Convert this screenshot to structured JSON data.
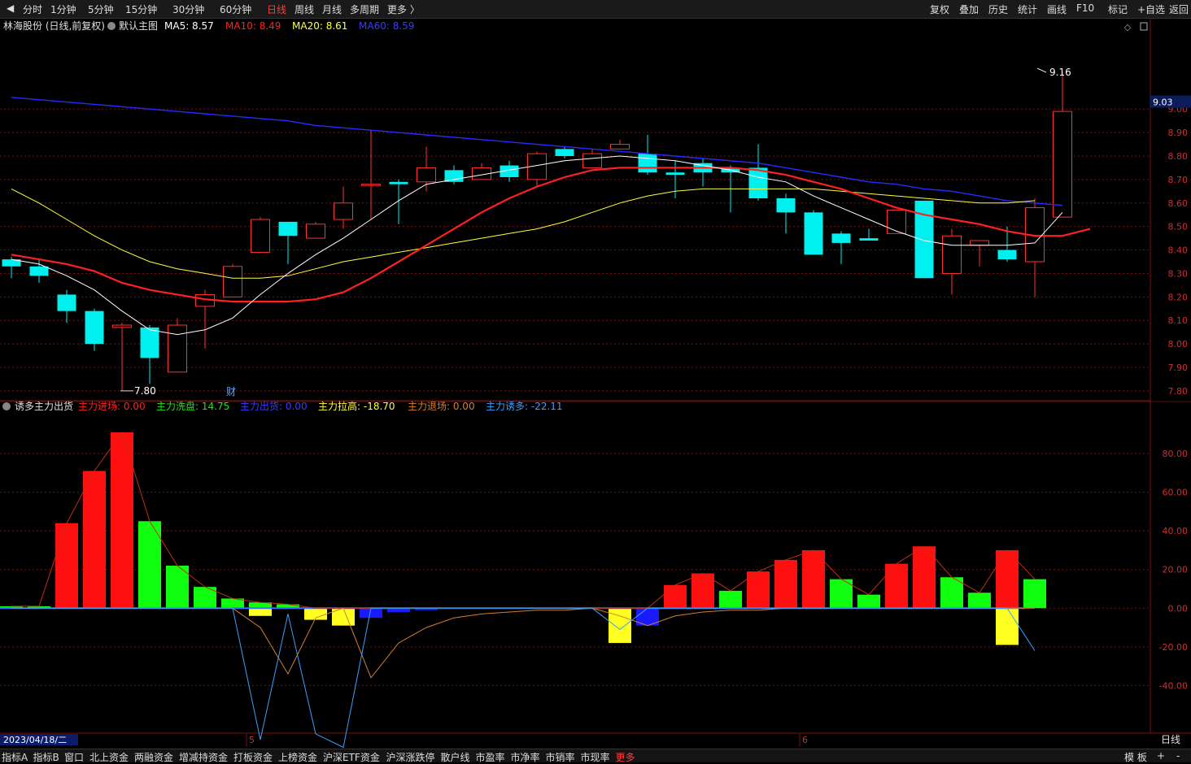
{
  "toolbar": {
    "left": [
      {
        "id": "fenshi",
        "label": "分时"
      },
      {
        "id": "1min",
        "label": "1分钟"
      },
      {
        "id": "5min",
        "label": "5分钟"
      },
      {
        "id": "15min",
        "label": "15分钟"
      },
      {
        "id": "30min",
        "label": "30分钟"
      },
      {
        "id": "60min",
        "label": "60分钟"
      },
      {
        "id": "day",
        "label": "日线",
        "active": true
      },
      {
        "id": "week",
        "label": "周线"
      },
      {
        "id": "month",
        "label": "月线"
      },
      {
        "id": "multi",
        "label": "多周期"
      },
      {
        "id": "more",
        "label": "更多 〉"
      }
    ],
    "right": [
      {
        "id": "fuquan",
        "label": "复权"
      },
      {
        "id": "diejia",
        "label": "叠加"
      },
      {
        "id": "lishi",
        "label": "历史"
      },
      {
        "id": "tongji",
        "label": "统计"
      },
      {
        "id": "huaxian",
        "label": "画线"
      },
      {
        "id": "f10",
        "label": "F10"
      },
      {
        "id": "biaoji",
        "label": "标记"
      },
      {
        "id": "zixuan",
        "label": "+自选"
      },
      {
        "id": "fanhui",
        "label": "返回"
      }
    ]
  },
  "main_header": {
    "stock": "林海股份 (日线,前复权)",
    "template": "默认主图",
    "ma": [
      {
        "label": "MA5: 8.57",
        "color": "#ffffff"
      },
      {
        "label": "MA10: 8.49",
        "color": "#ff2020"
      },
      {
        "label": "MA20: 8.61",
        "color": "#ffff40"
      },
      {
        "label": "MA60: 8.59",
        "color": "#3a3aff"
      }
    ]
  },
  "sub_header": {
    "indicator": "诱多主力出货",
    "items": [
      {
        "label": "主力进场: 0.00",
        "color": "#ff2020"
      },
      {
        "label": "主力洗盘: 14.75",
        "color": "#20e020"
      },
      {
        "label": "主力出货: 0.00",
        "color": "#3a3aff"
      },
      {
        "label": "主力拉高: -18.70",
        "color": "#ffff40"
      },
      {
        "label": "主力退场: 0.00",
        "color": "#d08030"
      },
      {
        "label": "主力诱多: -22.11",
        "color": "#3aa0ff"
      }
    ]
  },
  "price_badge": "9.03",
  "high_label": "9.16",
  "low_label": "7.80",
  "cai_marker": "财",
  "date_label": "2023/04/18/二",
  "month_markers": [
    {
      "label": "5",
      "index": 9
    },
    {
      "label": "6",
      "index": 29
    }
  ],
  "period_label": "日线",
  "bottom_tabs": [
    {
      "id": "zba",
      "label": "指标A"
    },
    {
      "id": "zbb",
      "label": "指标B"
    },
    {
      "id": "win",
      "label": "窗口"
    },
    {
      "id": "bszj",
      "label": "北上资金"
    },
    {
      "id": "lrzj",
      "label": "两融资金"
    },
    {
      "id": "zjcz",
      "label": "增减持资金"
    },
    {
      "id": "dbzj",
      "label": "打板资金"
    },
    {
      "id": "sbzj",
      "label": "上榜资金"
    },
    {
      "id": "hsetf",
      "label": "沪深ETF资金"
    },
    {
      "id": "hszdt",
      "label": "沪深涨跌停"
    },
    {
      "id": "shx",
      "label": "散户线"
    },
    {
      "id": "syl",
      "label": "市盈率"
    },
    {
      "id": "sjl",
      "label": "市净率"
    },
    {
      "id": "sxl",
      "label": "市销率"
    },
    {
      "id": "sxianl",
      "label": "市现率"
    },
    {
      "id": "more",
      "label": "更多",
      "active": true
    }
  ],
  "bottom_right": [
    {
      "id": "muban",
      "label": "模 板"
    },
    {
      "id": "plus",
      "label": "+"
    },
    {
      "id": "minus",
      "label": "-"
    }
  ],
  "colors": {
    "up": "#ff3030",
    "down": "#00f0f0",
    "ma5": "#ffffff",
    "ma10": "#ff2020",
    "ma20": "#ffff40",
    "ma60": "#2a2aff",
    "grid": "#7a1010",
    "axis_text": "#cc3030"
  },
  "chart_data": [
    {
      "type": "candlestick",
      "title": "林海股份 (日线,前复权)",
      "ylim": [
        7.72,
        9.25
      ],
      "yticks": [
        7.8,
        7.9,
        8.0,
        8.1,
        8.2,
        8.3,
        8.4,
        8.5,
        8.6,
        8.7,
        8.8,
        8.9,
        9.0
      ],
      "candles": [
        {
          "o": 8.36,
          "h": 8.37,
          "l": 8.28,
          "c": 8.33
        },
        {
          "o": 8.33,
          "h": 8.36,
          "l": 8.26,
          "c": 8.29
        },
        {
          "o": 8.21,
          "h": 8.23,
          "l": 8.09,
          "c": 8.14
        },
        {
          "o": 8.14,
          "h": 8.15,
          "l": 7.97,
          "c": 8.0
        },
        {
          "o": 8.07,
          "h": 8.09,
          "l": 7.8,
          "c": 8.08
        },
        {
          "o": 8.07,
          "h": 8.08,
          "l": 7.83,
          "c": 7.94
        },
        {
          "o": 7.88,
          "h": 8.11,
          "l": 7.88,
          "c": 8.08
        },
        {
          "o": 8.16,
          "h": 8.23,
          "l": 7.98,
          "c": 8.21
        },
        {
          "o": 8.2,
          "h": 8.34,
          "l": 8.2,
          "c": 8.33
        },
        {
          "o": 8.39,
          "h": 8.54,
          "l": 8.39,
          "c": 8.53
        },
        {
          "o": 8.52,
          "h": 8.52,
          "l": 8.34,
          "c": 8.46
        },
        {
          "o": 8.45,
          "h": 8.52,
          "l": 8.45,
          "c": 8.51
        },
        {
          "o": 8.53,
          "h": 8.67,
          "l": 8.49,
          "c": 8.6
        },
        {
          "o": 8.68,
          "h": 8.91,
          "l": 8.53,
          "c": 8.68
        },
        {
          "o": 8.69,
          "h": 8.7,
          "l": 8.51,
          "c": 8.68
        },
        {
          "o": 8.69,
          "h": 8.84,
          "l": 8.65,
          "c": 8.75
        },
        {
          "o": 8.74,
          "h": 8.76,
          "l": 8.68,
          "c": 8.69
        },
        {
          "o": 8.7,
          "h": 8.77,
          "l": 8.7,
          "c": 8.75
        },
        {
          "o": 8.76,
          "h": 8.78,
          "l": 8.69,
          "c": 8.71
        },
        {
          "o": 8.7,
          "h": 8.82,
          "l": 8.67,
          "c": 8.81
        },
        {
          "o": 8.83,
          "h": 8.84,
          "l": 8.79,
          "c": 8.8
        },
        {
          "o": 8.75,
          "h": 8.83,
          "l": 8.75,
          "c": 8.81
        },
        {
          "o": 8.83,
          "h": 8.87,
          "l": 8.83,
          "c": 8.85
        },
        {
          "o": 8.81,
          "h": 8.89,
          "l": 8.72,
          "c": 8.73
        },
        {
          "o": 8.73,
          "h": 8.78,
          "l": 8.62,
          "c": 8.72
        },
        {
          "o": 8.77,
          "h": 8.79,
          "l": 8.67,
          "c": 8.73
        },
        {
          "o": 8.75,
          "h": 8.76,
          "l": 8.56,
          "c": 8.73
        },
        {
          "o": 8.75,
          "h": 8.85,
          "l": 8.61,
          "c": 8.62
        },
        {
          "o": 8.62,
          "h": 8.64,
          "l": 8.47,
          "c": 8.56
        },
        {
          "o": 8.56,
          "h": 8.57,
          "l": 8.38,
          "c": 8.38
        },
        {
          "o": 8.47,
          "h": 8.48,
          "l": 8.34,
          "c": 8.43
        },
        {
          "o": 8.45,
          "h": 8.49,
          "l": 8.44,
          "c": 8.44
        },
        {
          "o": 8.47,
          "h": 8.57,
          "l": 8.47,
          "c": 8.57
        },
        {
          "o": 8.61,
          "h": 8.61,
          "l": 8.28,
          "c": 8.28
        },
        {
          "o": 8.3,
          "h": 8.49,
          "l": 8.21,
          "c": 8.46
        },
        {
          "o": 8.42,
          "h": 8.44,
          "l": 8.33,
          "c": 8.44
        },
        {
          "o": 8.4,
          "h": 8.5,
          "l": 8.35,
          "c": 8.36
        },
        {
          "o": 8.35,
          "h": 8.62,
          "l": 8.2,
          "c": 8.58
        },
        {
          "o": 8.54,
          "h": 9.16,
          "l": 8.54,
          "c": 8.99
        }
      ],
      "ma5": [
        8.36,
        8.34,
        8.29,
        8.23,
        8.14,
        8.06,
        8.04,
        8.06,
        8.11,
        8.21,
        8.3,
        8.38,
        8.45,
        8.53,
        8.61,
        8.68,
        8.7,
        8.72,
        8.74,
        8.76,
        8.78,
        8.79,
        8.8,
        8.79,
        8.78,
        8.76,
        8.74,
        8.71,
        8.69,
        8.63,
        8.58,
        8.53,
        8.48,
        8.44,
        8.42,
        8.42,
        8.42,
        8.43,
        8.56
      ],
      "ma10": [
        8.38,
        8.36,
        8.34,
        8.31,
        8.26,
        8.23,
        8.21,
        8.19,
        8.18,
        8.18,
        8.18,
        8.19,
        8.22,
        8.28,
        8.35,
        8.42,
        8.49,
        8.56,
        8.62,
        8.67,
        8.71,
        8.74,
        8.75,
        8.75,
        8.75,
        8.75,
        8.75,
        8.74,
        8.72,
        8.69,
        8.66,
        8.62,
        8.58,
        8.55,
        8.53,
        8.51,
        8.48,
        8.46,
        8.46,
        8.49
      ],
      "ma20": [
        8.66,
        8.6,
        8.53,
        8.46,
        8.4,
        8.35,
        8.32,
        8.3,
        8.28,
        8.28,
        8.29,
        8.32,
        8.35,
        8.37,
        8.39,
        8.41,
        8.43,
        8.45,
        8.47,
        8.49,
        8.52,
        8.56,
        8.6,
        8.63,
        8.65,
        8.66,
        8.66,
        8.66,
        8.66,
        8.66,
        8.65,
        8.64,
        8.63,
        8.62,
        8.61,
        8.6,
        8.6,
        8.61
      ],
      "ma60": [
        9.05,
        9.04,
        9.03,
        9.02,
        9.01,
        9.0,
        8.99,
        8.98,
        8.97,
        8.96,
        8.95,
        8.93,
        8.92,
        8.91,
        8.9,
        8.89,
        8.88,
        8.87,
        8.86,
        8.85,
        8.84,
        8.83,
        8.82,
        8.81,
        8.8,
        8.79,
        8.78,
        8.77,
        8.75,
        8.73,
        8.71,
        8.69,
        8.68,
        8.66,
        8.65,
        8.63,
        8.61,
        8.6,
        8.59
      ]
    },
    {
      "type": "bar",
      "title": "诱多主力出货",
      "ylim": [
        -68,
        96
      ],
      "yticks": [
        -40,
        -20,
        0,
        20,
        40,
        60,
        80
      ],
      "series": [
        {
          "name": "主力进场",
          "values": [
            0,
            0,
            44,
            71,
            91,
            0,
            0,
            0,
            0,
            0,
            0,
            0,
            0,
            0,
            0,
            0,
            0,
            0,
            0,
            0,
            0,
            0,
            0,
            0,
            12,
            18,
            0,
            19,
            25,
            30,
            0,
            0,
            23,
            32,
            0,
            0,
            30,
            0
          ]
        },
        {
          "name": "主力洗盘",
          "values": [
            1,
            1,
            0,
            0,
            0,
            45,
            22,
            11,
            5,
            3,
            2,
            0,
            0,
            0,
            0,
            0,
            0,
            0,
            0,
            0,
            0,
            0,
            0,
            0,
            0,
            0,
            9,
            0,
            0,
            0,
            15,
            7,
            0,
            0,
            16,
            8,
            0,
            15
          ]
        },
        {
          "name": "主力出货",
          "values": [
            0,
            0,
            0,
            0,
            0,
            0,
            0,
            0,
            0,
            0,
            0,
            0,
            0,
            -5,
            -2,
            -1,
            0,
            0,
            0,
            0,
            0,
            0,
            0,
            -9,
            0,
            0,
            0,
            0,
            0,
            0,
            0,
            0,
            0,
            0,
            0,
            0,
            0,
            0
          ]
        },
        {
          "name": "主力拉高",
          "values": [
            0,
            0,
            0,
            0,
            0,
            0,
            0,
            0,
            0,
            -4,
            0,
            -6,
            -9,
            0,
            0,
            0,
            0,
            0,
            0,
            0,
            0,
            0,
            -18,
            0,
            0,
            0,
            0,
            0,
            0,
            0,
            0,
            0,
            0,
            0,
            0,
            0,
            -19,
            0
          ]
        },
        {
          "name": "主力退场",
          "values": [
            0,
            0,
            0,
            0,
            0,
            0,
            0,
            0,
            0,
            -10,
            -34,
            -5,
            0,
            -36,
            -18,
            -10,
            -5,
            -3,
            -2,
            -1,
            -1,
            0,
            -4,
            -9,
            -4,
            -2,
            -1,
            -1,
            0,
            0,
            0,
            0,
            0,
            0,
            0,
            0,
            0,
            0
          ]
        },
        {
          "name": "主力诱多",
          "values": [
            0,
            0,
            0,
            0,
            0,
            0,
            0,
            0,
            0,
            -68,
            -3,
            -65,
            -72,
            0,
            0,
            0,
            0,
            0,
            0,
            0,
            0,
            0,
            -11,
            0,
            0,
            0,
            0,
            0,
            0,
            0,
            0,
            0,
            0,
            0,
            0,
            0,
            0,
            -22
          ]
        }
      ]
    }
  ]
}
